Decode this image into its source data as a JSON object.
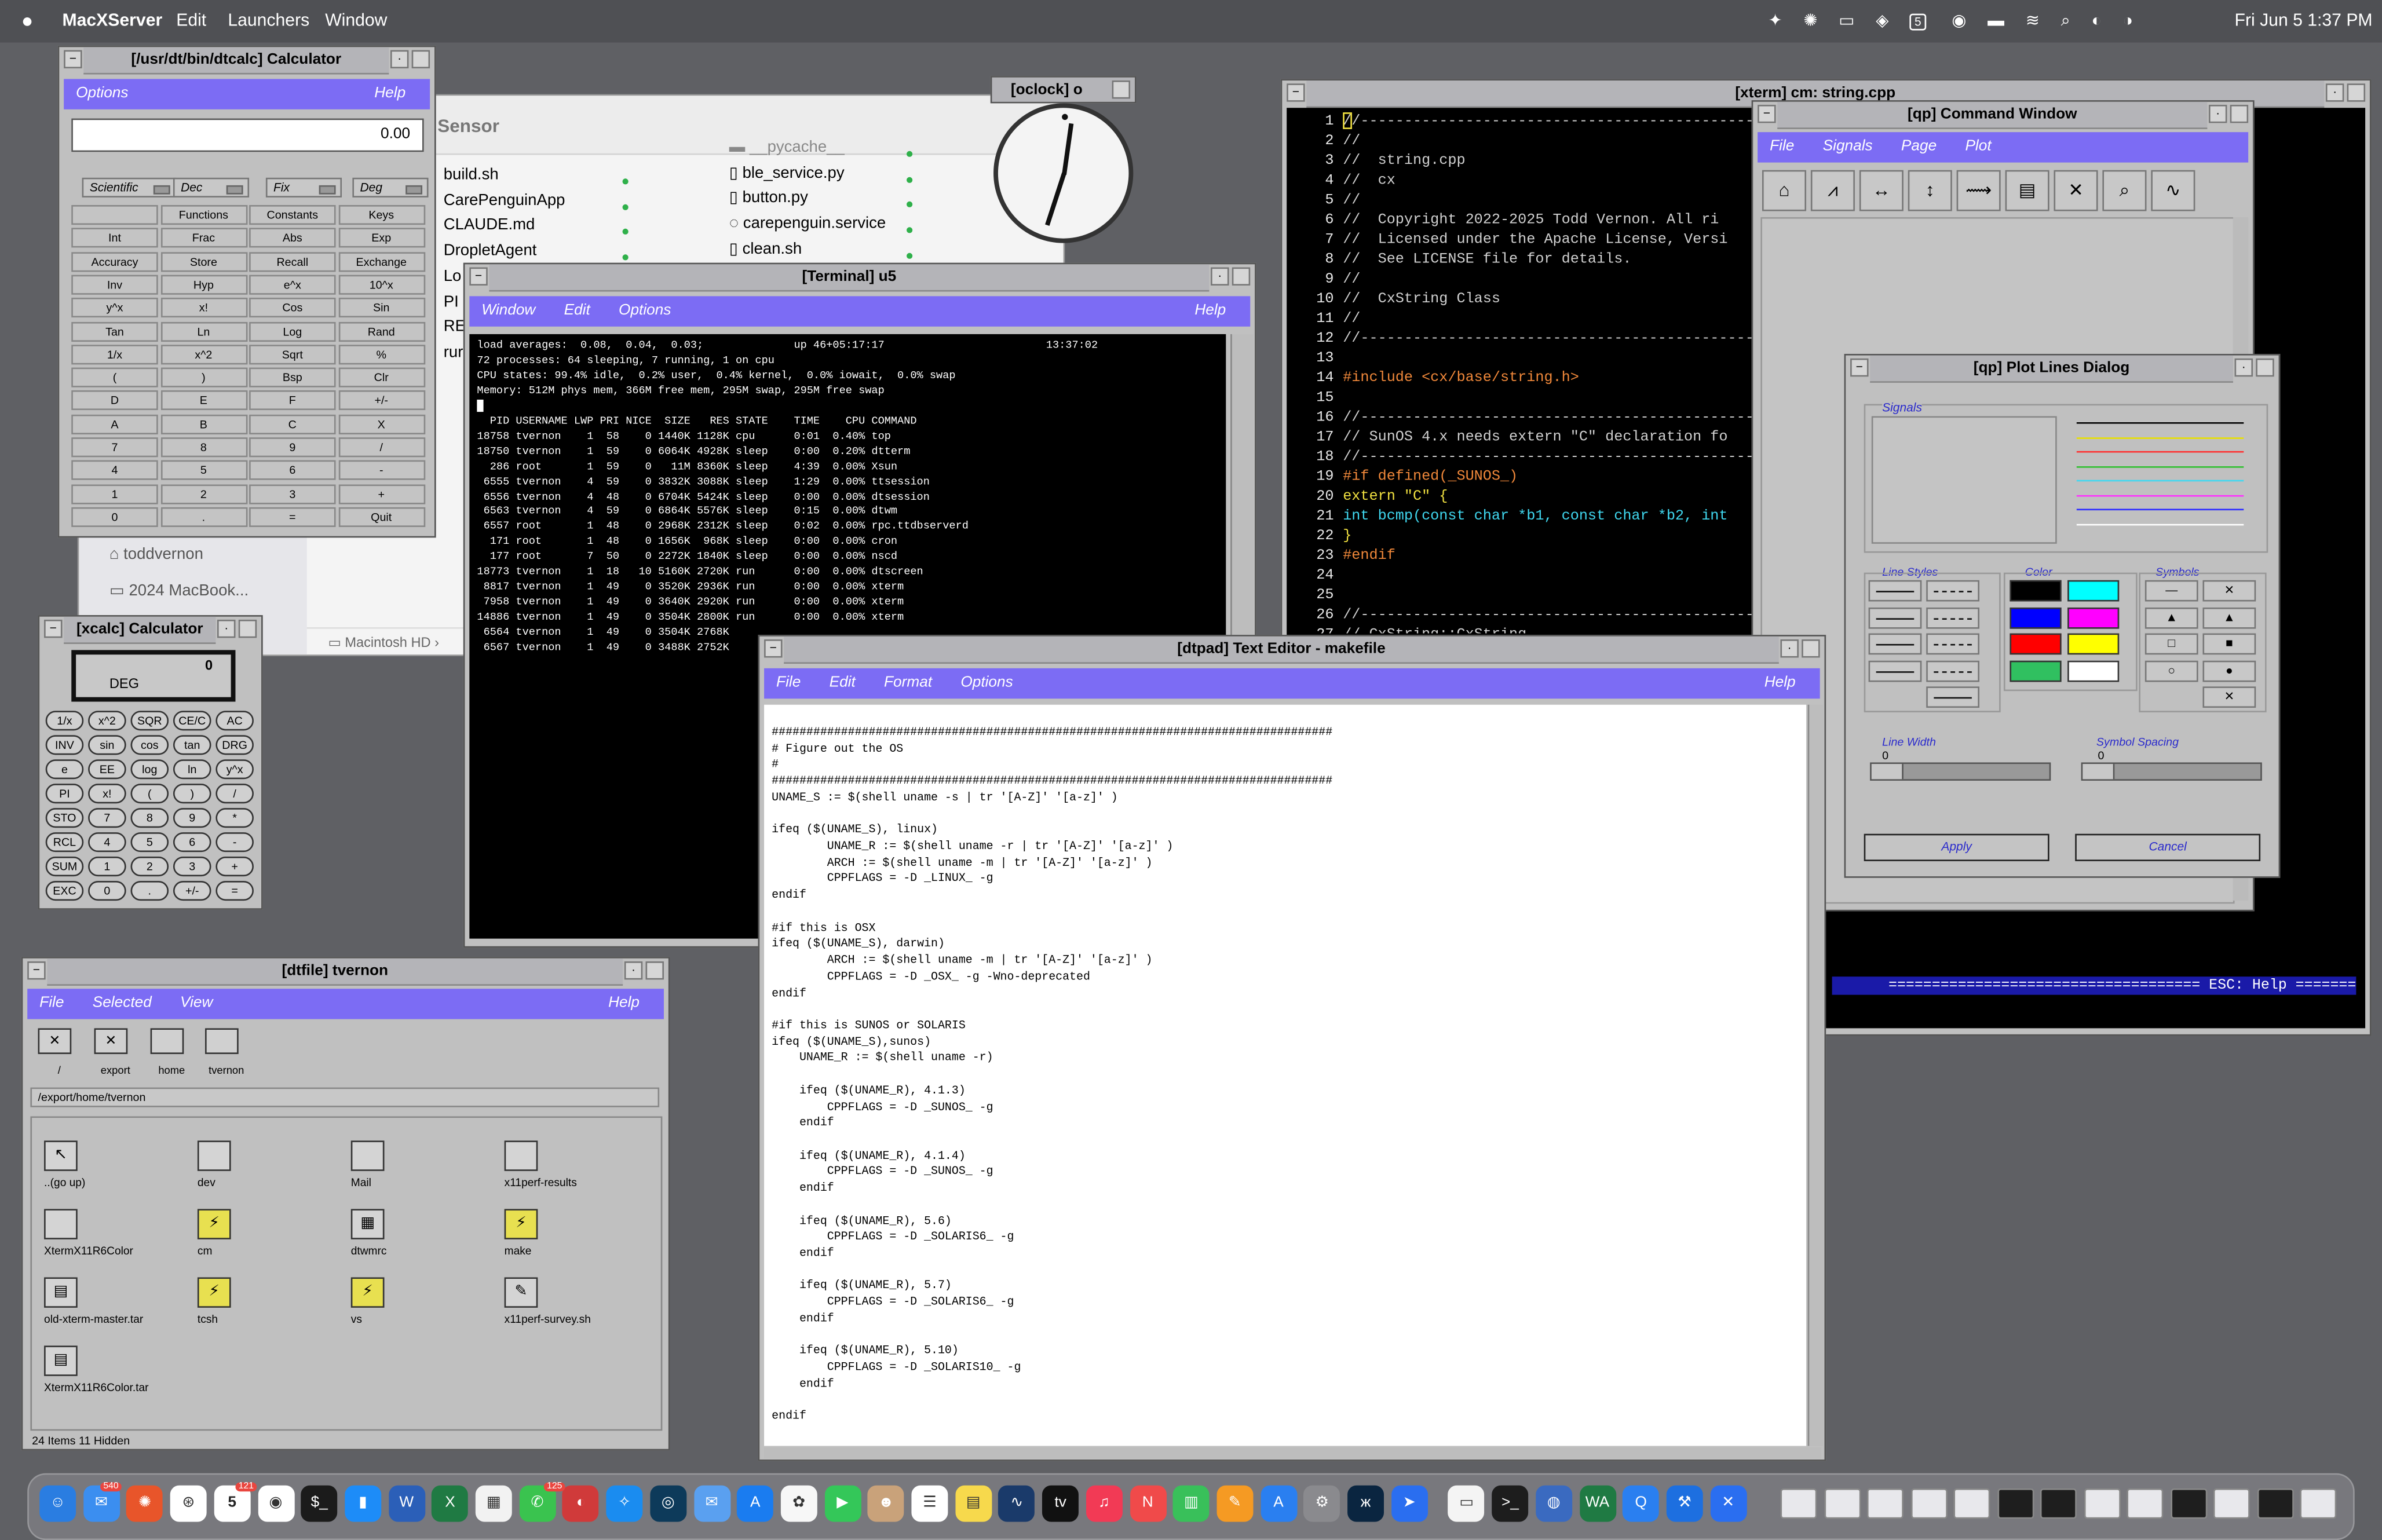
{
  "menubar": {
    "apple": "",
    "app": "MacXServer",
    "items": [
      "Edit",
      "Launchers",
      "Window"
    ],
    "clock": "Fri Jun 5  1:37 PM",
    "calendar_badge": "5"
  },
  "calc": {
    "title": "[/usr/dt/bin/dtcalc] Calculator",
    "menu": [
      "Options"
    ],
    "help": "Help",
    "display": "0.00",
    "selectors": [
      "Scientific",
      "Dec",
      "Fix",
      "Deg"
    ],
    "rows": [
      [
        "",
        "Functions",
        "Constants",
        "Keys"
      ],
      [
        "Int",
        "Frac",
        "Abs",
        "Exp"
      ],
      [
        "Accuracy",
        "Store",
        "Recall",
        "Exchange"
      ],
      [
        "Inv",
        "Hyp",
        "e^x",
        "10^x"
      ],
      [
        "y^x",
        "x!",
        "Cos",
        "Sin"
      ],
      [
        "Tan",
        "Ln",
        "Log",
        "Rand"
      ],
      [
        "1/x",
        "x^2",
        "Sqrt",
        "%"
      ],
      [
        "(",
        ")",
        "Bsp",
        "Clr"
      ],
      [
        "D",
        "E",
        "F",
        "+/-"
      ],
      [
        "A",
        "B",
        "C",
        "X"
      ],
      [
        "7",
        "8",
        "9",
        "/"
      ],
      [
        "4",
        "5",
        "6",
        "-"
      ],
      [
        "1",
        "2",
        "3",
        "+"
      ],
      [
        "0",
        ".",
        "=",
        "Quit"
      ]
    ]
  },
  "xcalc": {
    "title": "[xcalc] Calculator",
    "display": "0",
    "mode": "DEG",
    "rows": [
      [
        "1/x",
        "x^2",
        "SQR",
        "CE/C",
        "AC"
      ],
      [
        "INV",
        "sin",
        "cos",
        "tan",
        "DRG"
      ],
      [
        "e",
        "EE",
        "log",
        "ln",
        "y^x"
      ],
      [
        "PI",
        "x!",
        "(",
        ")",
        "/"
      ],
      [
        "STO",
        "7",
        "8",
        "9",
        "*"
      ],
      [
        "RCL",
        "4",
        "5",
        "6",
        "-"
      ],
      [
        "SUM",
        "1",
        "2",
        "3",
        "+"
      ],
      [
        "EXC",
        "0",
        ".",
        "+/-",
        "="
      ]
    ]
  },
  "finder": {
    "title": "Sensor",
    "left_files": [
      "build.sh",
      "CarePenguinApp",
      "CLAUDE.md",
      "DropletAgent",
      "Lo",
      "PI",
      "RE",
      "rur"
    ],
    "right_files": [
      "__pycache__",
      "ble_service.py",
      "button.py",
      "carepenguin.service",
      "clean.sh"
    ],
    "sidebar": [
      "toddvernon",
      "2024 MacBook..."
    ],
    "path": "Macintosh HD"
  },
  "oclock": {
    "title": "[oclock] o"
  },
  "terminal": {
    "title": "[Terminal] u5",
    "menu": [
      "Window",
      "Edit",
      "Options"
    ],
    "help": "Help",
    "lines": [
      "load averages:  0.08,  0.04,  0.03;              up 46+05:17:17                         13:37:02",
      "72 processes: 64 sleeping, 7 running, 1 on cpu",
      "CPU states: 99.4% idle,  0.2% user,  0.4% kernel,  0.0% iowait,  0.0% swap",
      "Memory: 512M phys mem, 366M free mem, 295M swap, 295M free swap",
      "█",
      "  PID USERNAME LWP PRI NICE  SIZE   RES STATE    TIME    CPU COMMAND",
      "18758 tvernon    1  58    0 1440K 1128K cpu      0:01  0.40% top",
      "18750 tvernon    1  59    0 6064K 4928K sleep    0:00  0.20% dtterm",
      "  286 root       1  59    0   11M 8360K sleep    4:39  0.00% Xsun",
      " 6555 tvernon    4  59    0 3832K 3088K sleep    1:29  0.00% ttsession",
      " 6556 tvernon    4  48    0 6704K 5424K sleep    0:00  0.00% dtsession",
      " 6563 tvernon    4  59    0 6864K 5576K sleep    0:15  0.00% dtwm",
      " 6557 root       1  48    0 2968K 2312K sleep    0:02  0.00% rpc.ttdbserverd",
      "  171 root       1  48    0 1656K  968K sleep    0:00  0.00% cron",
      "  177 root       7  50    0 2272K 1840K sleep    0:00  0.00% nscd",
      "18773 tvernon    1  18   10 5160K 2720K run      0:00  0.00% dtscreen",
      " 8817 tvernon    1  49    0 3520K 2936K run      0:00  0.00% xterm",
      " 7958 tvernon    1  49    0 3640K 2920K run      0:00  0.00% xterm",
      "14886 tvernon    1  49    0 3504K 2800K run      0:00  0.00% xterm",
      " 6564 tvernon    1  49    0 3504K 2768K",
      " 6567 tvernon    1  49    0 3488K 2752K"
    ]
  },
  "xterm": {
    "title": "[xterm] cm: string.cpp",
    "lines": [
      {
        "n": "1",
        "t": "//----------------------------------------------------------",
        "c": "#d0d0d0"
      },
      {
        "n": "2",
        "t": "//",
        "c": "#d0d0d0"
      },
      {
        "n": "3",
        "t": "//  string.cpp",
        "c": "#d0d0d0"
      },
      {
        "n": "4",
        "t": "//  cx",
        "c": "#d0d0d0"
      },
      {
        "n": "5",
        "t": "//",
        "c": "#d0d0d0"
      },
      {
        "n": "6",
        "t": "//  Copyright 2022-2025 Todd Vernon. All ri",
        "c": "#d0d0d0"
      },
      {
        "n": "7",
        "t": "//  Licensed under the Apache License, Versi",
        "c": "#d0d0d0"
      },
      {
        "n": "8",
        "t": "//  See LICENSE file for details.",
        "c": "#d0d0d0"
      },
      {
        "n": "9",
        "t": "//",
        "c": "#d0d0d0"
      },
      {
        "n": "10",
        "t": "//  CxString Class",
        "c": "#d0d0d0"
      },
      {
        "n": "11",
        "t": "//",
        "c": "#d0d0d0"
      },
      {
        "n": "12",
        "t": "//----------------------------------------------------------",
        "c": "#d0d0d0"
      },
      {
        "n": "13",
        "t": "",
        "c": "#d0d0d0"
      },
      {
        "n": "14",
        "t": "#include <cx/base/string.h>",
        "c": "#f0883a"
      },
      {
        "n": "15",
        "t": "",
        "c": "#d0d0d0"
      },
      {
        "n": "16",
        "t": "//----------------------------------------------------------",
        "c": "#d0d0d0"
      },
      {
        "n": "17",
        "t": "// SunOS 4.x needs extern \"C\" declaration fo",
        "c": "#d0d0d0"
      },
      {
        "n": "18",
        "t": "//----------------------------------------------------------",
        "c": "#d0d0d0"
      },
      {
        "n": "19",
        "t": "#if defined(_SUNOS_)",
        "c": "#f0883a"
      },
      {
        "n": "20",
        "t": "extern \"C\" {",
        "c": "#f0e040"
      },
      {
        "n": "21",
        "t": "int bcmp(const char *b1, const char *b2, int",
        "c": "#40d8f0"
      },
      {
        "n": "22",
        "t": "}",
        "c": "#f0e040"
      },
      {
        "n": "23",
        "t": "#endif",
        "c": "#f0883a"
      },
      {
        "n": "24",
        "t": "",
        "c": "#d0d0d0"
      },
      {
        "n": "25",
        "t": "",
        "c": "#d0d0d0"
      },
      {
        "n": "26",
        "t": "//----------------------------------------------------------",
        "c": "#d0d0d0"
      },
      {
        "n": "27",
        "t": "// CxString::CxString",
        "c": "#d0d0d0"
      }
    ],
    "status": "==================================== ESC: Help ======="
  },
  "qp": {
    "title": "[qp] Command Window",
    "menu": [
      "File",
      "Signals",
      "Page",
      "Plot"
    ],
    "tools": [
      "open",
      "signal",
      "zoom-h",
      "zoom-v",
      "scale",
      "page",
      "xy",
      "search",
      "eps"
    ]
  },
  "plotlines": {
    "title": "[qp] Plot Lines Dialog",
    "signals_label": "Signals",
    "line_styles_label": "Line Styles",
    "color_label": "Color",
    "symbols_label": "Symbols",
    "line_width_label": "Line Width",
    "line_width_value": "0",
    "symbol_spacing_label": "Symbol Spacing",
    "symbol_spacing_value": "0",
    "apply": "Apply",
    "cancel": "Cancel",
    "sample_colors": [
      "#000000",
      "#e8e000",
      "#ff3030",
      "#30c030",
      "#40d8f0",
      "#ff30ff",
      "#3030ff",
      "#ffffff"
    ],
    "palette": [
      "#000000",
      "#00ffff",
      "#0000ff",
      "#ff00ff",
      "#ff0000",
      "#ffff00",
      "#30c060",
      "#ffffff"
    ]
  },
  "dtfile": {
    "title": "[dtfile] tvernon",
    "menu": [
      "File",
      "Selected",
      "View"
    ],
    "help": "Help",
    "crumbs": [
      "/",
      "export",
      "home",
      "tvernon"
    ],
    "path": "/export/home/tvernon",
    "items": [
      {
        "name": "..(go up)",
        "icon": "up-folder-icon"
      },
      {
        "name": "dev",
        "icon": "folder-icon"
      },
      {
        "name": "Mail",
        "icon": "folder-icon"
      },
      {
        "name": "x11perf-results",
        "icon": "folder-icon"
      },
      {
        "name": "XtermX11R6Color",
        "icon": "folder-icon"
      },
      {
        "name": "cm",
        "icon": "executable-icon"
      },
      {
        "name": "dtwmrc",
        "icon": "text-file-icon"
      },
      {
        "name": "make",
        "icon": "executable-icon"
      },
      {
        "name": "old-xterm-master.tar",
        "icon": "archive-icon"
      },
      {
        "name": "tcsh",
        "icon": "executable-icon"
      },
      {
        "name": "vs",
        "icon": "executable-icon"
      },
      {
        "name": "x11perf-survey.sh",
        "icon": "script-icon"
      },
      {
        "name": "XtermX11R6Color.tar",
        "icon": "archive-icon"
      }
    ],
    "status": "24 Items 11 Hidden"
  },
  "dtpad": {
    "title": "[dtpad] Text Editor - makefile",
    "menu": [
      "File",
      "Edit",
      "Format",
      "Options"
    ],
    "help": "Help",
    "text": "#################################################################################\n# Figure out the OS\n#\n#################################################################################\nUNAME_S := $(shell uname -s | tr '[A-Z]' '[a-z]' )\n\nifeq ($(UNAME_S), linux)\n        UNAME_R := $(shell uname -r | tr '[A-Z]' '[a-z]' )\n        ARCH := $(shell uname -m | tr '[A-Z]' '[a-z]' )\n        CPPFLAGS = -D _LINUX_ -g\nendif\n\n#if this is OSX\nifeq ($(UNAME_S), darwin)\n        ARCH := $(shell uname -m | tr '[A-Z]' '[a-z]' )\n        CPPFLAGS = -D _OSX_ -g -Wno-deprecated\nendif\n\n#if this is SUNOS or SOLARIS\nifeq ($(UNAME_S),sunos)\n    UNAME_R := $(shell uname -r)\n\n    ifeq ($(UNAME_R), 4.1.3)\n        CPPFLAGS = -D _SUNOS_ -g\n    endif\n\n    ifeq ($(UNAME_R), 4.1.4)\n        CPPFLAGS = -D _SUNOS_ -g\n    endif\n\n    ifeq ($(UNAME_R), 5.6)\n        CPPFLAGS = -D _SOLARIS6_ -g\n    endif\n\n    ifeq ($(UNAME_R), 5.7)\n        CPPFLAGS = -D _SOLARIS6_ -g\n    endif\n\n    ifeq ($(UNAME_R), 5.10)\n        CPPFLAGS = -D _SOLARIS10_ -g\n    endif\n\nendif"
  },
  "dock": {
    "mail_badge": "540",
    "calendar_day": "5",
    "calendar_badge": "121",
    "messages_badge": "125",
    "apps": [
      {
        "name": "finder-icon",
        "color": "#2a7de1",
        "glyph": "☺"
      },
      {
        "name": "mail-icon",
        "color": "#3b8ef0",
        "glyph": "✉"
      },
      {
        "name": "sunburst-icon",
        "color": "#e8552a",
        "glyph": "✺"
      },
      {
        "name": "chatgpt-icon",
        "color": "#ffffff",
        "glyph": "⊛"
      },
      {
        "name": "calendar-icon",
        "color": "#ffffff",
        "glyph": ""
      },
      {
        "name": "chrome-icon",
        "color": "#ffffff",
        "glyph": "◉"
      },
      {
        "name": "terminal-icon",
        "color": "#1b1b1b",
        "glyph": "$_"
      },
      {
        "name": "keynote-icon",
        "color": "#1d8cf8",
        "glyph": "▮"
      },
      {
        "name": "word-icon",
        "color": "#2b5fb8",
        "glyph": "W"
      },
      {
        "name": "excel-icon",
        "color": "#1f7a43",
        "glyph": "X"
      },
      {
        "name": "numbers-grid-icon",
        "color": "#f2f2f2",
        "glyph": "▦"
      },
      {
        "name": "messages-icon",
        "color": "#3ac34f",
        "glyph": "✆"
      },
      {
        "name": "affinity-icon",
        "color": "#d03a3a",
        "glyph": "◐"
      },
      {
        "name": "safari-icon",
        "color": "#1a8cf0",
        "glyph": "✧"
      },
      {
        "name": "comms-icon",
        "color": "#0d3a5a",
        "glyph": "◎"
      },
      {
        "name": "mail-alt-icon",
        "color": "#5aa0f0",
        "glyph": "✉"
      },
      {
        "name": "appstore-icon",
        "color": "#1a7cf0",
        "glyph": "A"
      },
      {
        "name": "photos-icon",
        "color": "#f7f7f7",
        "glyph": "✿"
      },
      {
        "name": "facetime-icon",
        "color": "#34c759",
        "glyph": "▶"
      },
      {
        "name": "contacts-icon",
        "color": "#c9a27a",
        "glyph": "☻"
      },
      {
        "name": "reminders-icon",
        "color": "#ffffff",
        "glyph": "☰"
      },
      {
        "name": "notes-icon",
        "color": "#f7d94c",
        "glyph": "▤"
      },
      {
        "name": "stocks-icon",
        "color": "#1a3a6a",
        "glyph": "∿"
      },
      {
        "name": "appletv-icon",
        "color": "#111111",
        "glyph": "tv"
      },
      {
        "name": "music-icon",
        "color": "#f23a55",
        "glyph": "♫"
      },
      {
        "name": "news-icon",
        "color": "#f04a4a",
        "glyph": "N"
      },
      {
        "name": "charts-icon",
        "color": "#39c05a",
        "glyph": "▥"
      },
      {
        "name": "pages-icon",
        "color": "#f59a23",
        "glyph": "✎"
      },
      {
        "name": "appstore-alt-icon",
        "color": "#2a7ff0",
        "glyph": "A"
      },
      {
        "name": "settings-icon",
        "color": "#8a8a8e",
        "glyph": "⚙"
      },
      {
        "name": "butterfly-icon",
        "color": "#0a2540",
        "glyph": "ж"
      },
      {
        "name": "testflight-icon",
        "color": "#2a6ef0",
        "glyph": "➤"
      },
      {
        "name": "doc-icon",
        "color": "#f4f4f4",
        "glyph": "▭"
      },
      {
        "name": "term-icon",
        "color": "#1d1d1d",
        "glyph": ">_"
      },
      {
        "name": "disk-icon",
        "color": "#3a6ac0",
        "glyph": "◍"
      },
      {
        "name": "whatsapp-icon",
        "color": "#1f7a43",
        "glyph": "WA"
      },
      {
        "name": "quicksilver-icon",
        "color": "#2a7ff0",
        "glyph": "Q"
      },
      {
        "name": "xcode-icon",
        "color": "#1d6fe0",
        "glyph": "⚒"
      },
      {
        "name": "xquartz-icon",
        "color": "#2a6ef0",
        "glyph": "✕"
      }
    ],
    "recent": [
      "doc",
      "photo",
      "win",
      "win",
      "win",
      "term",
      "term",
      "win",
      "win",
      "term",
      "doc",
      "term",
      "trash"
    ]
  },
  "colors": {
    "desktop": "#5f6064",
    "menu_purple": "#7c6cf4",
    "window_gray": "#c0c0c0",
    "title_gray": "#b4b4b8"
  }
}
